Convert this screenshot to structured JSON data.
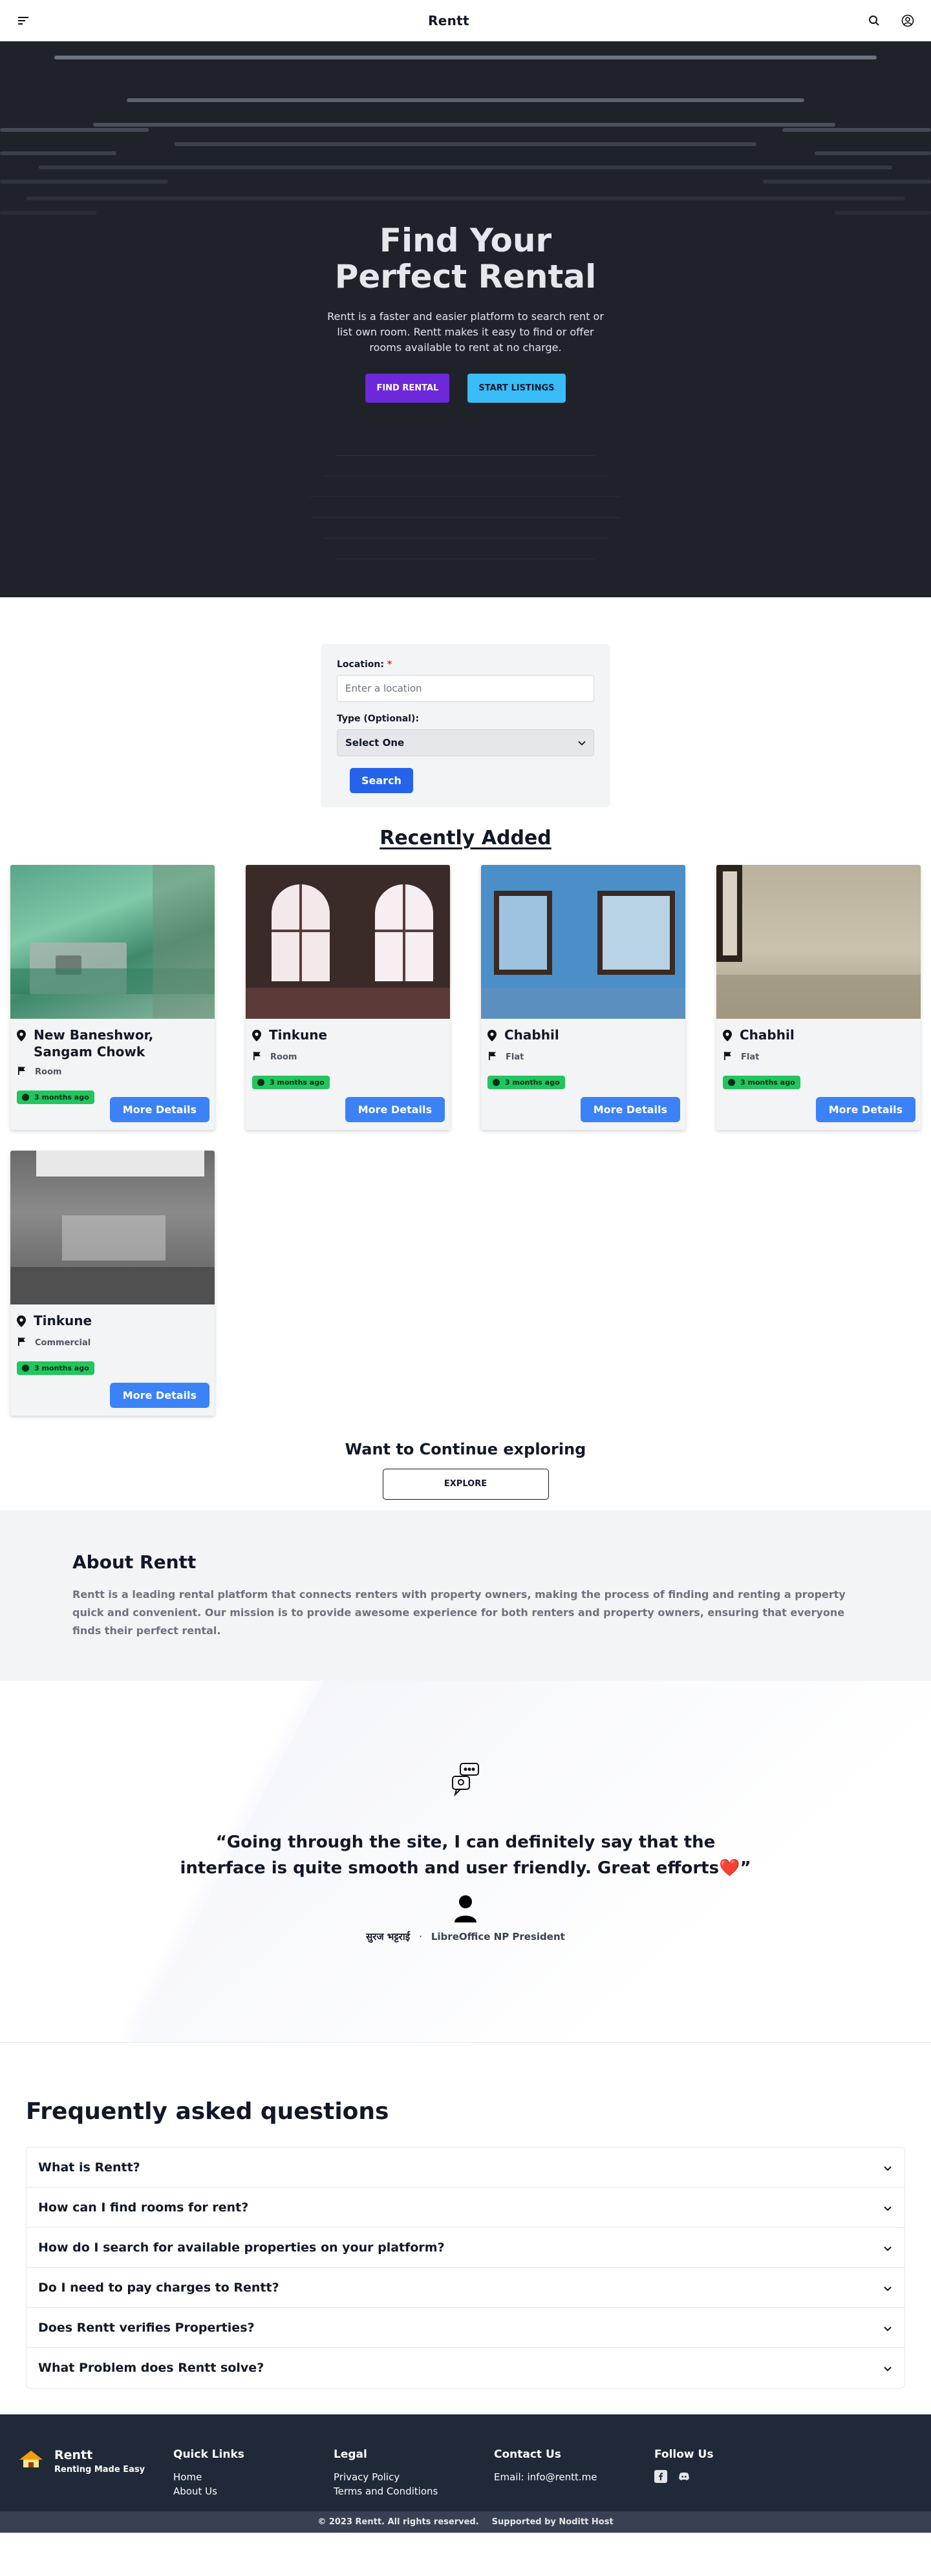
{
  "nav": {
    "brand": "Rentt"
  },
  "hero": {
    "title": "Find Your Perfect Rental",
    "description": "Rentt is a faster and easier platform to search rent or list own room. Rentt makes it easy to find or offer rooms available to rent at no charge.",
    "find_label": "FIND RENTAL",
    "start_label": "START LISTINGS",
    "colors": {
      "bg": "#1f2229",
      "primary": "#6d28d9",
      "secondary": "#38bdf8"
    }
  },
  "search": {
    "location_label": "Location:",
    "required_mark": "*",
    "location_placeholder": "Enter a location",
    "type_label": "Type (Optional):",
    "type_value": "Select One",
    "button": "Search"
  },
  "recent": {
    "title": "Recently Added",
    "more_label": "More Details",
    "listings": [
      {
        "location": "New Baneshwor, Sangam Chowk",
        "type": "Room",
        "added": "3 months ago"
      },
      {
        "location": "Tinkune",
        "type": "Room",
        "added": "3 months ago"
      },
      {
        "location": "Chabhil",
        "type": "Flat",
        "added": "3 months ago"
      },
      {
        "location": "Chabhil",
        "type": "Flat",
        "added": "3 months ago"
      },
      {
        "location": "Tinkune",
        "type": "Commercial",
        "added": "3 months ago"
      }
    ]
  },
  "explore": {
    "heading": "Want to Continue exploring",
    "button": "EXPLORE"
  },
  "about": {
    "title": "About Rentt",
    "text": "Rentt is a leading rental platform that connects renters with property owners, making the process of finding and renting a property quick and convenient. Our mission is to provide awesome experience for both renters and property owners, ensuring that everyone finds their perfect rental."
  },
  "testimonial": {
    "quote": "“Going through the site, I can definitely say that the interface is quite smooth and user friendly. Great efforts❤️”",
    "name": "सुरज भट्टराई",
    "separator": "·",
    "role": "LibreOffice NP President"
  },
  "faq": {
    "title": "Frequently asked questions",
    "items": [
      "What is Rentt?",
      "How can I find rooms for rent?",
      "How do I search for available properties on your platform?",
      "Do I need to pay charges to Rentt?",
      "Does Rentt verifies Properties?",
      "What Problem does Rentt solve?"
    ]
  },
  "footer": {
    "brand": "Rentt",
    "tagline": "Renting Made Easy",
    "quick_title": "Quick Links",
    "home": "Home",
    "about": "About Us",
    "legal_title": "Legal",
    "privacy": "Privacy Policy",
    "terms": "Terms and Conditions",
    "contact_title": "Contact Us",
    "email": "Email: info@rentt.me",
    "follow_title": "Follow Us",
    "copyright": "© 2023 Rentt. All rights reserved.",
    "supported": "Supported by Noditt Host"
  }
}
